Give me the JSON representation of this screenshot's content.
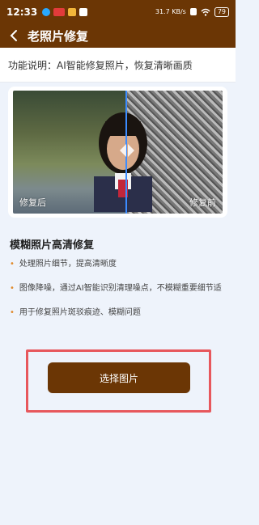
{
  "status_bar": {
    "time": "12:33",
    "network_speed": "31.7 KB/s",
    "battery": "79"
  },
  "header": {
    "title": "老照片修复"
  },
  "function_description": "功能说明：AI智能修复照片，恢复清晰画质",
  "comparison": {
    "after_label": "修复后",
    "before_label": "修复前"
  },
  "section": {
    "title": "模糊照片高清修复",
    "features": [
      "处理照片细节，提高清晰度",
      "图像降噪，通过AI智能识别清理噪点，不模糊重要细节适",
      "用于修复照片斑驳痕迹、模糊问题"
    ]
  },
  "actions": {
    "select_image_label": "选择图片"
  },
  "colors": {
    "brand": "#6b3605",
    "bullet": "#e08a2b",
    "highlight": "#e7575c",
    "divider": "#3c8cff"
  }
}
